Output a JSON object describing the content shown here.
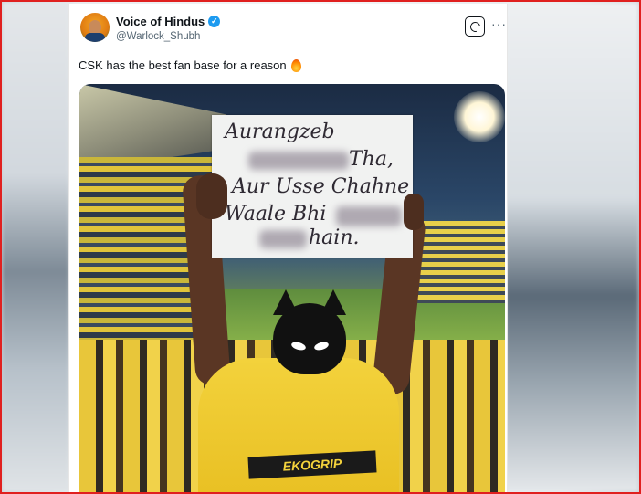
{
  "post": {
    "author_name": "Voice of Hindus",
    "author_handle": "@Warlock_Shubh",
    "verified_mark": "✓",
    "text": "CSK has the best fan base for a reason",
    "emoji_icon": "fire-emoji",
    "more_label": "···"
  },
  "image": {
    "sign_lines": [
      "Aurangzeb",
      "Tha,",
      "Aur Usse Chahne",
      "Waale Bhi",
      "hain."
    ],
    "jersey_text": "EKOGRIP"
  },
  "colors": {
    "frame_border": "#e0201f",
    "verified_badge": "#1d9bf0",
    "jersey_yellow": "#f3d23c"
  }
}
